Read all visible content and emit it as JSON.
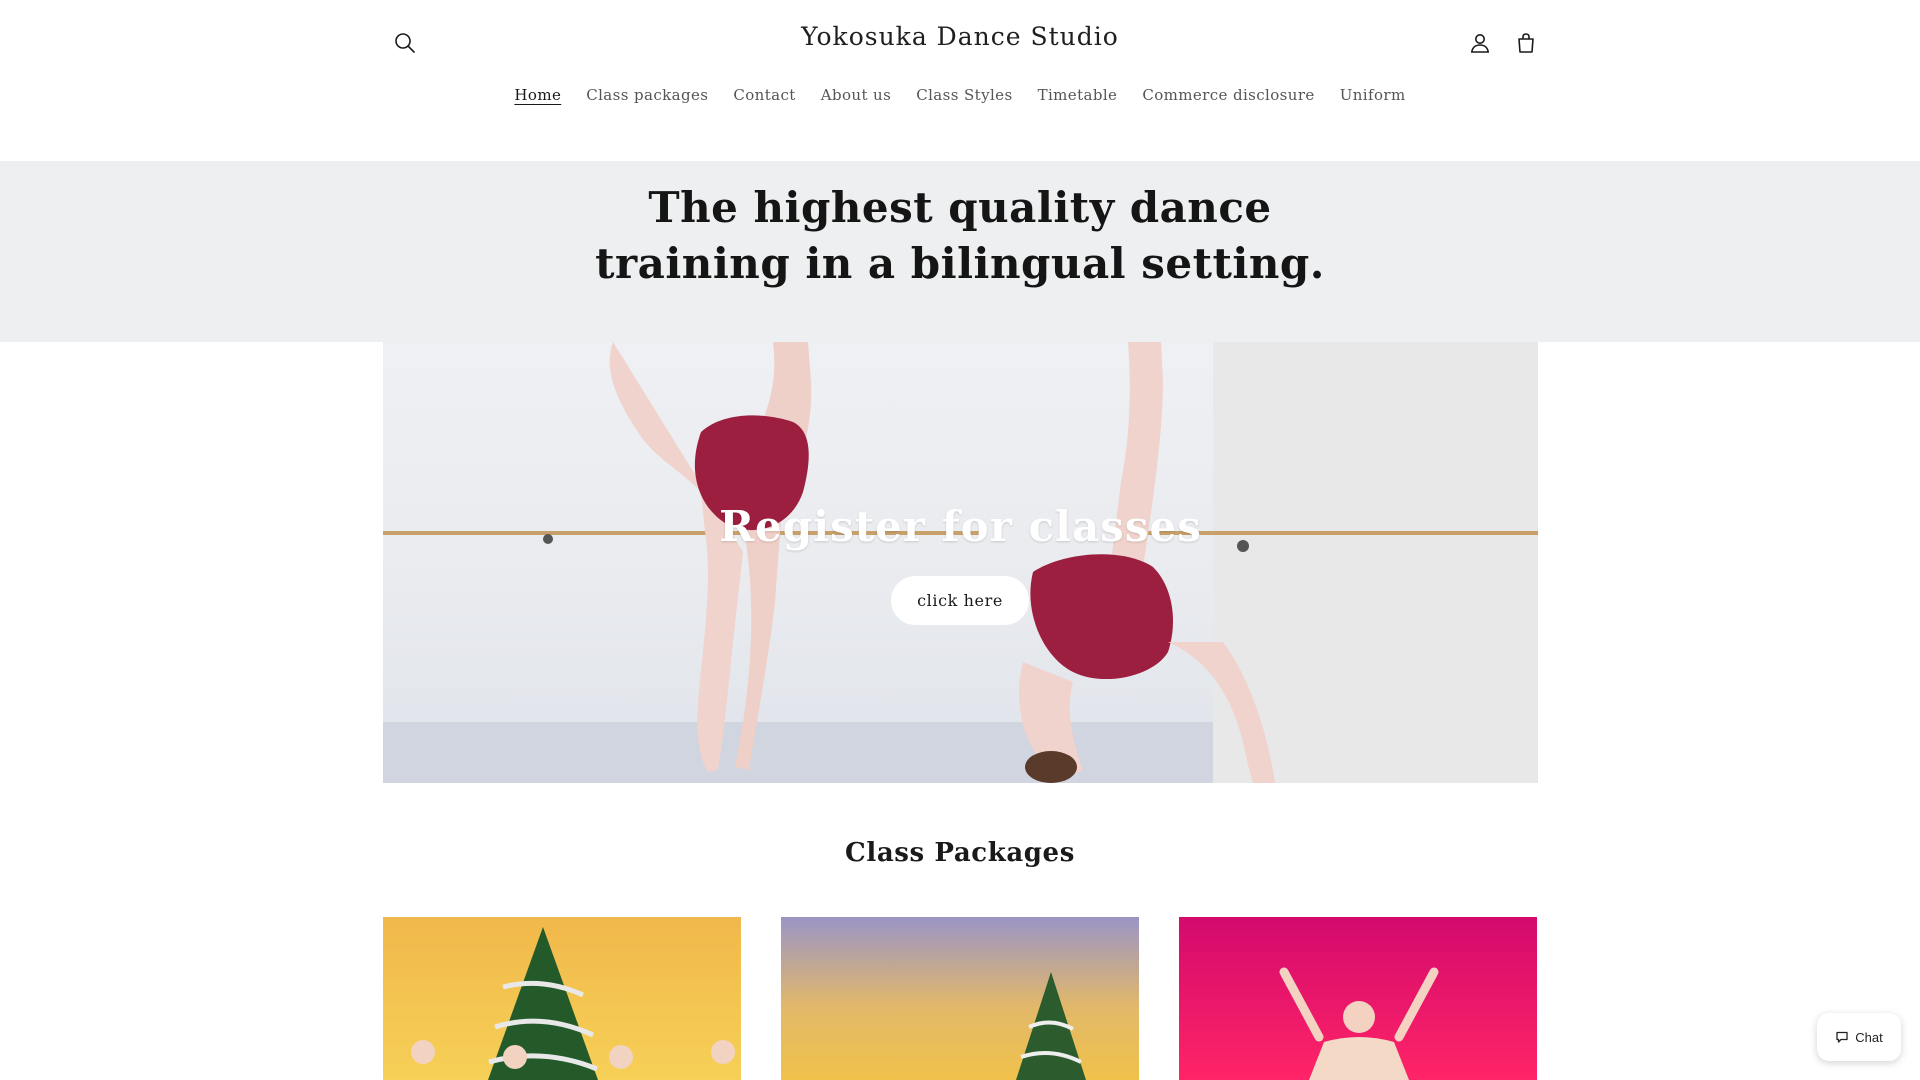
{
  "header": {
    "site_title": "Yokosuka Dance Studio",
    "icons": {
      "search": "search-icon",
      "account": "account-icon",
      "cart": "cart-icon"
    }
  },
  "nav": {
    "items": [
      {
        "label": "Home",
        "active": true
      },
      {
        "label": "Class packages"
      },
      {
        "label": "Contact"
      },
      {
        "label": "About us"
      },
      {
        "label": "Class Styles"
      },
      {
        "label": "Timetable"
      },
      {
        "label": "Commerce disclosure"
      },
      {
        "label": "Uniform"
      }
    ]
  },
  "tagline": "The highest quality dance training in a bilingual setting.",
  "hero": {
    "heading": "Register for classes",
    "button_label": "click here"
  },
  "packages": {
    "title": "Class Packages"
  },
  "chat": {
    "label": "Chat",
    "icon": "chat-bubble-icon"
  },
  "colors": {
    "leotard": "#9c1f3f",
    "band_bg": "#edeff0",
    "card3_bg": "#e8106a"
  }
}
